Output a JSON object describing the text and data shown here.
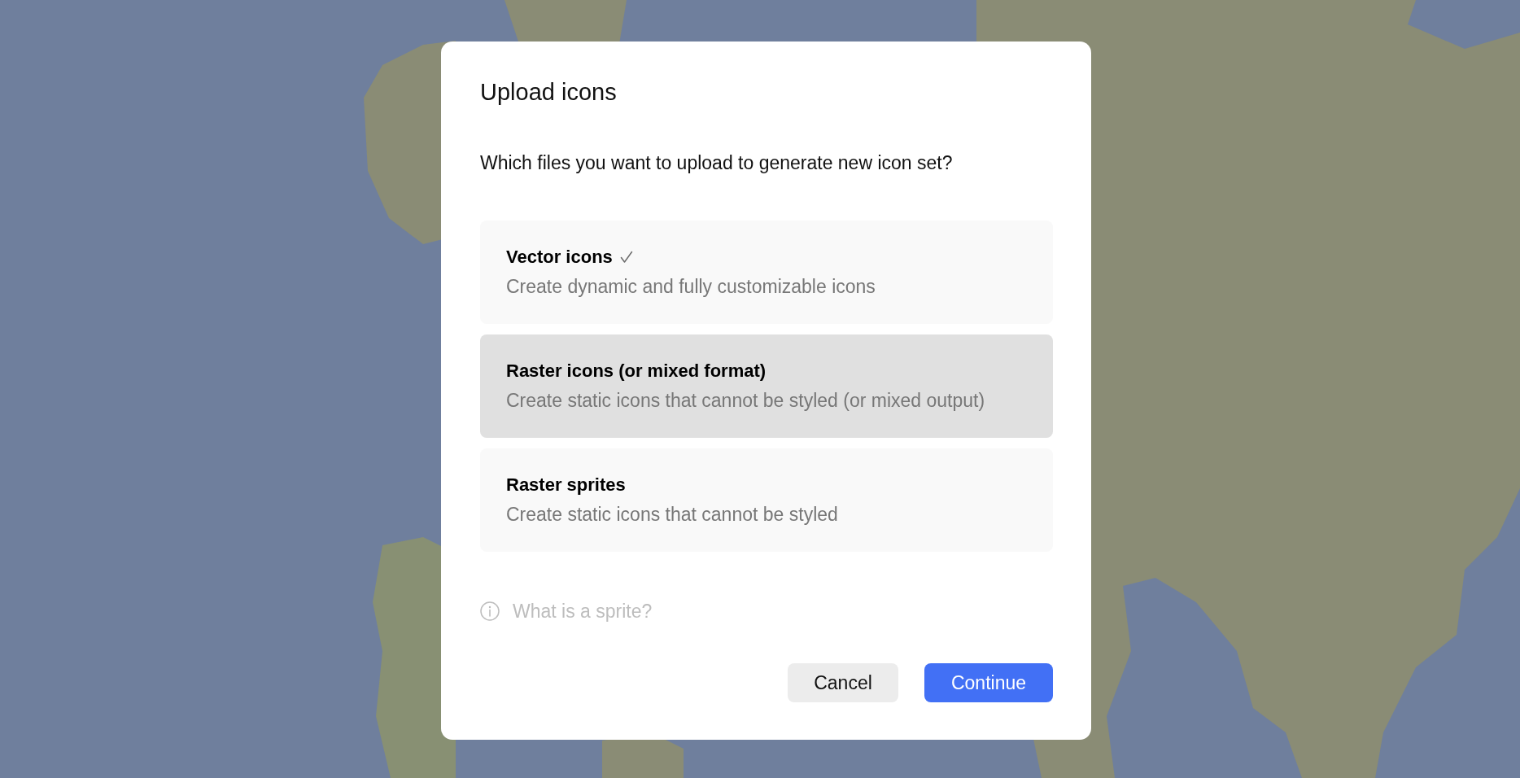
{
  "dialog": {
    "title": "Upload icons",
    "question": "Which files you want to upload to generate new icon set?",
    "options": [
      {
        "title": "Vector icons",
        "description": "Create dynamic and fully customizable icons",
        "selected": true,
        "hovered": false
      },
      {
        "title": "Raster icons (or mixed format)",
        "description": "Create static icons that cannot be styled (or mixed output)",
        "selected": false,
        "hovered": true
      },
      {
        "title": "Raster sprites",
        "description": "Create static icons that cannot be styled",
        "selected": false,
        "hovered": false
      }
    ],
    "help_link": "What is a sprite?",
    "buttons": [
      {
        "label": "Cancel",
        "kind": "secondary"
      },
      {
        "label": "Continue",
        "kind": "primary"
      }
    ]
  }
}
